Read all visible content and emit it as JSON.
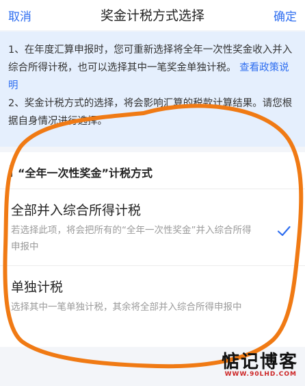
{
  "navbar": {
    "cancel_label": "取消",
    "title": "奖金计税方式选择",
    "confirm_label": "确定"
  },
  "notice": {
    "line1_text": "1、在年度汇算申报时，您可重新选择将全年一次性奖金收入并入综合所得计税，也可以选择其中一笔奖金单独计税。",
    "policy_link": "查看政策说明",
    "line2_text": "2、奖金计税方式的选择，将会影响汇算的税款计算结果。请您根据自身情况进行选择。"
  },
  "section": {
    "title": "“全年一次性奖金”计税方式"
  },
  "options": [
    {
      "title": "全部并入综合所得计税",
      "description": "若选择此项，将会把所有的“全年一次性奖金”并入综合所得申报中",
      "selected": true
    },
    {
      "title": "单独计税",
      "description": "选择其中一笔单独计税，其余将全部并入综合所得申报中",
      "selected": false
    }
  ],
  "watermark": {
    "main": "惦记博客",
    "sub": "WWW.90LHD.COM"
  },
  "colors": {
    "accent": "#2d6df0",
    "notice_background": "#e5effd",
    "annotation": "#f07a14"
  }
}
